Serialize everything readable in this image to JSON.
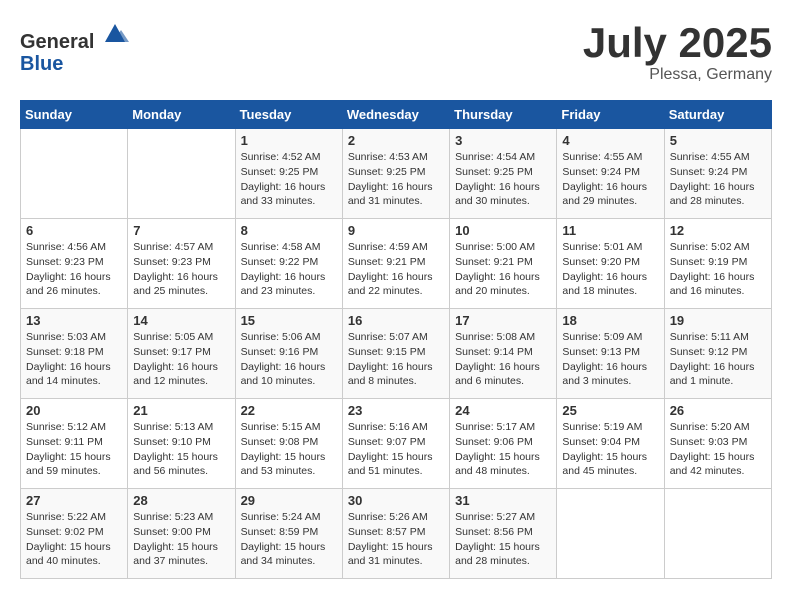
{
  "header": {
    "logo_general": "General",
    "logo_blue": "Blue",
    "month": "July 2025",
    "location": "Plessa, Germany"
  },
  "weekdays": [
    "Sunday",
    "Monday",
    "Tuesday",
    "Wednesday",
    "Thursday",
    "Friday",
    "Saturday"
  ],
  "weeks": [
    [
      {
        "day": "",
        "info": ""
      },
      {
        "day": "",
        "info": ""
      },
      {
        "day": "1",
        "info": "Sunrise: 4:52 AM\nSunset: 9:25 PM\nDaylight: 16 hours\nand 33 minutes."
      },
      {
        "day": "2",
        "info": "Sunrise: 4:53 AM\nSunset: 9:25 PM\nDaylight: 16 hours\nand 31 minutes."
      },
      {
        "day": "3",
        "info": "Sunrise: 4:54 AM\nSunset: 9:25 PM\nDaylight: 16 hours\nand 30 minutes."
      },
      {
        "day": "4",
        "info": "Sunrise: 4:55 AM\nSunset: 9:24 PM\nDaylight: 16 hours\nand 29 minutes."
      },
      {
        "day": "5",
        "info": "Sunrise: 4:55 AM\nSunset: 9:24 PM\nDaylight: 16 hours\nand 28 minutes."
      }
    ],
    [
      {
        "day": "6",
        "info": "Sunrise: 4:56 AM\nSunset: 9:23 PM\nDaylight: 16 hours\nand 26 minutes."
      },
      {
        "day": "7",
        "info": "Sunrise: 4:57 AM\nSunset: 9:23 PM\nDaylight: 16 hours\nand 25 minutes."
      },
      {
        "day": "8",
        "info": "Sunrise: 4:58 AM\nSunset: 9:22 PM\nDaylight: 16 hours\nand 23 minutes."
      },
      {
        "day": "9",
        "info": "Sunrise: 4:59 AM\nSunset: 9:21 PM\nDaylight: 16 hours\nand 22 minutes."
      },
      {
        "day": "10",
        "info": "Sunrise: 5:00 AM\nSunset: 9:21 PM\nDaylight: 16 hours\nand 20 minutes."
      },
      {
        "day": "11",
        "info": "Sunrise: 5:01 AM\nSunset: 9:20 PM\nDaylight: 16 hours\nand 18 minutes."
      },
      {
        "day": "12",
        "info": "Sunrise: 5:02 AM\nSunset: 9:19 PM\nDaylight: 16 hours\nand 16 minutes."
      }
    ],
    [
      {
        "day": "13",
        "info": "Sunrise: 5:03 AM\nSunset: 9:18 PM\nDaylight: 16 hours\nand 14 minutes."
      },
      {
        "day": "14",
        "info": "Sunrise: 5:05 AM\nSunset: 9:17 PM\nDaylight: 16 hours\nand 12 minutes."
      },
      {
        "day": "15",
        "info": "Sunrise: 5:06 AM\nSunset: 9:16 PM\nDaylight: 16 hours\nand 10 minutes."
      },
      {
        "day": "16",
        "info": "Sunrise: 5:07 AM\nSunset: 9:15 PM\nDaylight: 16 hours\nand 8 minutes."
      },
      {
        "day": "17",
        "info": "Sunrise: 5:08 AM\nSunset: 9:14 PM\nDaylight: 16 hours\nand 6 minutes."
      },
      {
        "day": "18",
        "info": "Sunrise: 5:09 AM\nSunset: 9:13 PM\nDaylight: 16 hours\nand 3 minutes."
      },
      {
        "day": "19",
        "info": "Sunrise: 5:11 AM\nSunset: 9:12 PM\nDaylight: 16 hours\nand 1 minute."
      }
    ],
    [
      {
        "day": "20",
        "info": "Sunrise: 5:12 AM\nSunset: 9:11 PM\nDaylight: 15 hours\nand 59 minutes."
      },
      {
        "day": "21",
        "info": "Sunrise: 5:13 AM\nSunset: 9:10 PM\nDaylight: 15 hours\nand 56 minutes."
      },
      {
        "day": "22",
        "info": "Sunrise: 5:15 AM\nSunset: 9:08 PM\nDaylight: 15 hours\nand 53 minutes."
      },
      {
        "day": "23",
        "info": "Sunrise: 5:16 AM\nSunset: 9:07 PM\nDaylight: 15 hours\nand 51 minutes."
      },
      {
        "day": "24",
        "info": "Sunrise: 5:17 AM\nSunset: 9:06 PM\nDaylight: 15 hours\nand 48 minutes."
      },
      {
        "day": "25",
        "info": "Sunrise: 5:19 AM\nSunset: 9:04 PM\nDaylight: 15 hours\nand 45 minutes."
      },
      {
        "day": "26",
        "info": "Sunrise: 5:20 AM\nSunset: 9:03 PM\nDaylight: 15 hours\nand 42 minutes."
      }
    ],
    [
      {
        "day": "27",
        "info": "Sunrise: 5:22 AM\nSunset: 9:02 PM\nDaylight: 15 hours\nand 40 minutes."
      },
      {
        "day": "28",
        "info": "Sunrise: 5:23 AM\nSunset: 9:00 PM\nDaylight: 15 hours\nand 37 minutes."
      },
      {
        "day": "29",
        "info": "Sunrise: 5:24 AM\nSunset: 8:59 PM\nDaylight: 15 hours\nand 34 minutes."
      },
      {
        "day": "30",
        "info": "Sunrise: 5:26 AM\nSunset: 8:57 PM\nDaylight: 15 hours\nand 31 minutes."
      },
      {
        "day": "31",
        "info": "Sunrise: 5:27 AM\nSunset: 8:56 PM\nDaylight: 15 hours\nand 28 minutes."
      },
      {
        "day": "",
        "info": ""
      },
      {
        "day": "",
        "info": ""
      }
    ]
  ]
}
